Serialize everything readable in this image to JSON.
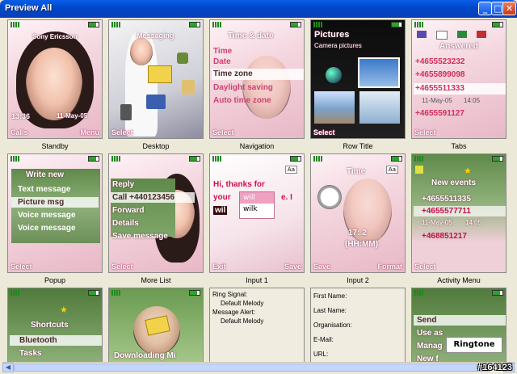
{
  "window": {
    "title": "Preview All"
  },
  "tiles": {
    "standby": {
      "caption": "Standby",
      "operator": "Sony Ericsson",
      "time": "13:36",
      "date": "11-May-05",
      "left": "Calls",
      "right": "Menu"
    },
    "desktop": {
      "caption": "Desktop",
      "title": "Messaging",
      "left": "Select"
    },
    "navigation": {
      "caption": "Navigation",
      "title": "Time & date",
      "items": [
        "Time",
        "Date",
        "Time zone",
        "Daylight saving",
        "Auto time zone"
      ],
      "left": "Select"
    },
    "rowtitle": {
      "caption": "Row Title",
      "title": "Pictures",
      "subtitle": "Camera pictures",
      "left": "Select"
    },
    "tabs": {
      "caption": "Tabs",
      "title": "Answered",
      "numbers": [
        "+4655523232",
        "+4655899098",
        "+4655511333",
        "+4655591127"
      ],
      "stamp": "11-May-05",
      "stamp_time": "14:05",
      "left": "Select"
    },
    "popup": {
      "caption": "Popup",
      "items": [
        "Write new",
        "Text message",
        "Picture msg",
        "Voice message",
        "Voice message"
      ],
      "left": "Select"
    },
    "morelist": {
      "caption": "More List",
      "items": [
        "Reply",
        "Call +440123456",
        "Forward",
        "Details",
        "Save message"
      ],
      "left": "Select"
    },
    "input1": {
      "caption": "Input 1",
      "mode": "Aa",
      "line1": "Hi, thanks for",
      "line2a": "your ",
      "line2b": "e. I",
      "typed": "wil",
      "suggestions": [
        "will",
        "wilk"
      ],
      "left": "Exit",
      "right": "Save"
    },
    "input2": {
      "caption": "Input 2",
      "mode": "Aa",
      "title": "Time",
      "time": "17: 2",
      "format": "(HH:MM)",
      "left": "Save",
      "right": "Format"
    },
    "activity": {
      "caption": "Activity Menu",
      "title": "New events",
      "numbers": [
        "+4655511335",
        "+4655577711",
        "+468851217"
      ],
      "stamp": "11-May-05",
      "stamp_time": "14:05",
      "left": "Select"
    },
    "shortcuts": {
      "title": "Shortcuts",
      "items": [
        "Bluetooth",
        "Tasks"
      ]
    },
    "downloading": {
      "text": "Downloading Mi"
    },
    "ringtone": {
      "items": [
        "Send",
        "Use as",
        "Manag",
        "New f"
      ],
      "popup": "Ringtone"
    }
  },
  "info_left": {
    "lines": [
      "Ring Signal:",
      "Default Melody",
      "Message Alert:",
      "Default Melody"
    ]
  },
  "info_right": {
    "lines": [
      "First Name:",
      "Last Name:",
      "Organisation:",
      "E-Mail:",
      "URL:"
    ]
  },
  "watermark": "#164123"
}
